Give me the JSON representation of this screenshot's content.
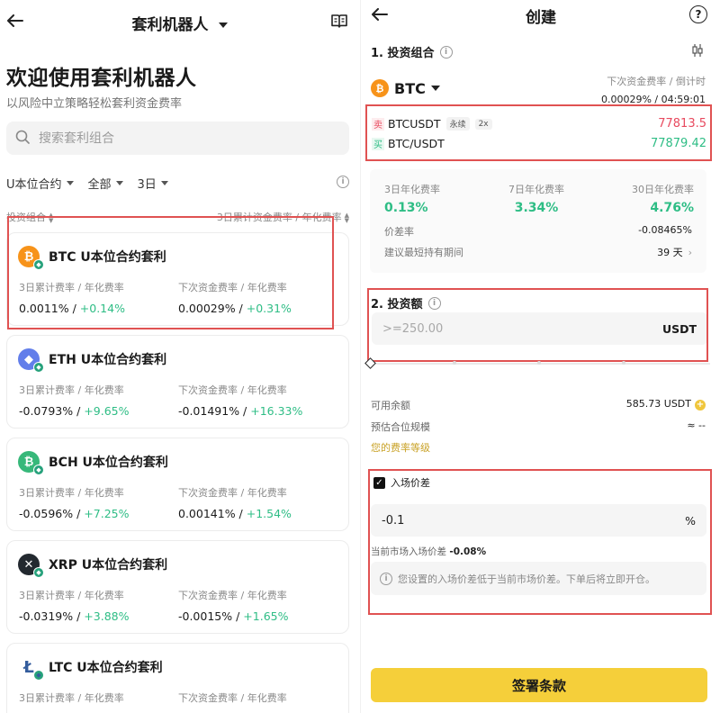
{
  "left": {
    "header": {
      "title": "套利机器人",
      "back_icon": "arrow-left-icon",
      "book_icon": "book-icon"
    },
    "welcome": {
      "title": "欢迎使用套利机器人",
      "subtitle": "以风险中立策略轻松套利资金费率"
    },
    "search": {
      "placeholder": "搜索套利组合",
      "icon": "search-icon"
    },
    "filters": [
      {
        "label": "U本位合约"
      },
      {
        "label": "全部"
      },
      {
        "label": "3日"
      }
    ],
    "columns": {
      "left": "投资组合",
      "right": "3日累计资金费率 / 年化费率"
    },
    "cards": [
      {
        "coin": "BTC",
        "symbol": "₿",
        "color": "#f7931a",
        "title": "BTC U本位合约套利",
        "label1": "3日累计费率 / 年化费率",
        "v1a": "0.0011% / ",
        "v1b": "+0.14%",
        "label2": "下次资金费率 / 年化费率",
        "v2a": "0.00029% / ",
        "v2b": "+0.31%"
      },
      {
        "coin": "ETH",
        "symbol": "◆",
        "color": "#627eea",
        "title": "ETH U本位合约套利",
        "label1": "3日累计费率 / 年化费率",
        "v1a": "-0.0793% / ",
        "v1b": "+9.65%",
        "label2": "下次资金费率 / 年化费率",
        "v2a": "-0.01491% / ",
        "v2b": "+16.33%"
      },
      {
        "coin": "BCH",
        "symbol": "₿",
        "color": "#37b87a",
        "title": "BCH U本位合约套利",
        "label1": "3日累计费率 / 年化费率",
        "v1a": "-0.0596% / ",
        "v1b": "+7.25%",
        "label2": "下次资金费率 / 年化费率",
        "v2a": "0.00141% / ",
        "v2b": "+1.54%"
      },
      {
        "coin": "XRP",
        "symbol": "✕",
        "color": "#23292f",
        "title": "XRP U本位合约套利",
        "label1": "3日累计费率 / 年化费率",
        "v1a": "-0.0319% / ",
        "v1b": "+3.88%",
        "label2": "下次资金费率 / 年化费率",
        "v2a": "-0.0015% / ",
        "v2b": "+1.65%"
      },
      {
        "coin": "LTC",
        "symbol": "Ł",
        "color": "#ffffff",
        "title": "LTC U本位合约套利",
        "label1": "3日累计费率 / 年化费率",
        "v1a": "",
        "v1b": "",
        "label2": "下次资金费率 / 年化费率",
        "v2a": "",
        "v2b": ""
      }
    ]
  },
  "right": {
    "header": {
      "title": "创建",
      "back_icon": "arrow-left-icon",
      "help_label": "?"
    },
    "section1": {
      "title": "1. 投资组合"
    },
    "coin_select": {
      "symbol": "₿",
      "label": "BTC"
    },
    "next_rate": {
      "label": "下次资金费率 / 倒计时",
      "value": "0.00029% / 04:59:01"
    },
    "pairs": {
      "sell": {
        "side": "卖",
        "name": "BTCUSDT",
        "tag1": "永续",
        "tag2": "2x",
        "price": "77813.5"
      },
      "buy": {
        "side": "买",
        "name": "BTC/USDT",
        "price": "77879.42"
      }
    },
    "stats": {
      "d3": {
        "label": "3日年化费率",
        "value": "0.13%"
      },
      "d7": {
        "label": "7日年化费率",
        "value": "3.34%"
      },
      "d30": {
        "label": "30日年化费率",
        "value": "4.76%"
      },
      "spread_label": "价差率",
      "spread_value": "-0.08465%",
      "hold_label": "建议最短持有期间",
      "hold_value": "39 天"
    },
    "section2": {
      "title": "2. 投资额"
    },
    "amount": {
      "placeholder": ">=250.00",
      "unit": "USDT"
    },
    "balance": {
      "label": "可用余额",
      "value": "585.73 USDT"
    },
    "position": {
      "label": "预估合位规模",
      "value": "≈ --"
    },
    "fee_level": "您的费率等级",
    "entry": {
      "checkbox_label": "入场价差",
      "value": "-0.1",
      "unit": "%"
    },
    "current_spread": {
      "label": "当前市场入场价差",
      "value": "-0.08%"
    },
    "notice": "您设置的入场价差低于当前市场价差。下单后将立即开仓。",
    "submit": "签署条款"
  }
}
